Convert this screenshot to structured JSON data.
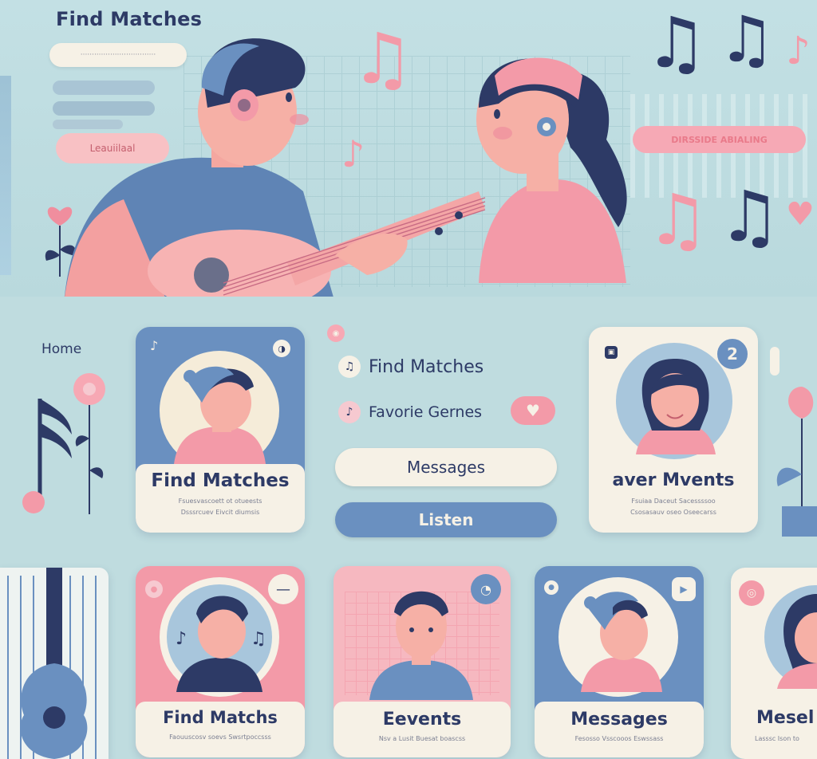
{
  "hero": {
    "title": "Find Matches",
    "search_text": "·································",
    "button_label": "Leauiilaal",
    "pink_bar_label": "DIRSSIDE ABIALING"
  },
  "nav": {
    "home": "Home"
  },
  "cards_top": [
    {
      "title": "Find Matches",
      "sub1": "Fsuesvascoett ot otueests",
      "sub2": "Dsssrcuev Eivcit diumsis"
    },
    {
      "title": "aver Mvents",
      "badge": "2",
      "sub1": "Fsuiaa Daceut  Sacessssoo",
      "sub2": "Csosasauv oseo  Oseecarss"
    }
  ],
  "menu": {
    "find_matches": "Find Matches",
    "favorite_genres": "Favorie Gernes",
    "messages": "Messages",
    "listen": "Listen"
  },
  "cards_bottom": [
    {
      "title": "Find Matchs",
      "sub": "Faouuscosv soevs Swsrtpoccsss"
    },
    {
      "title": "Eevents",
      "sub": "Nsv a Lusit Buesat boascss"
    },
    {
      "title": "Messages",
      "sub": "Fesosso  Vsscooos  Eswssass"
    },
    {
      "title": "Mesel",
      "sub": "Lasssc  Ison to"
    }
  ],
  "colors": {
    "navy": "#2d3a66",
    "pink": "#f39aa8",
    "blue": "#6a90c0",
    "cream": "#f6f1e6",
    "background": "#bfdcdf"
  },
  "icons": [
    "music-note-icon",
    "heart-icon",
    "bell-icon",
    "speaker-icon",
    "guitar-icon",
    "flower-icon"
  ]
}
